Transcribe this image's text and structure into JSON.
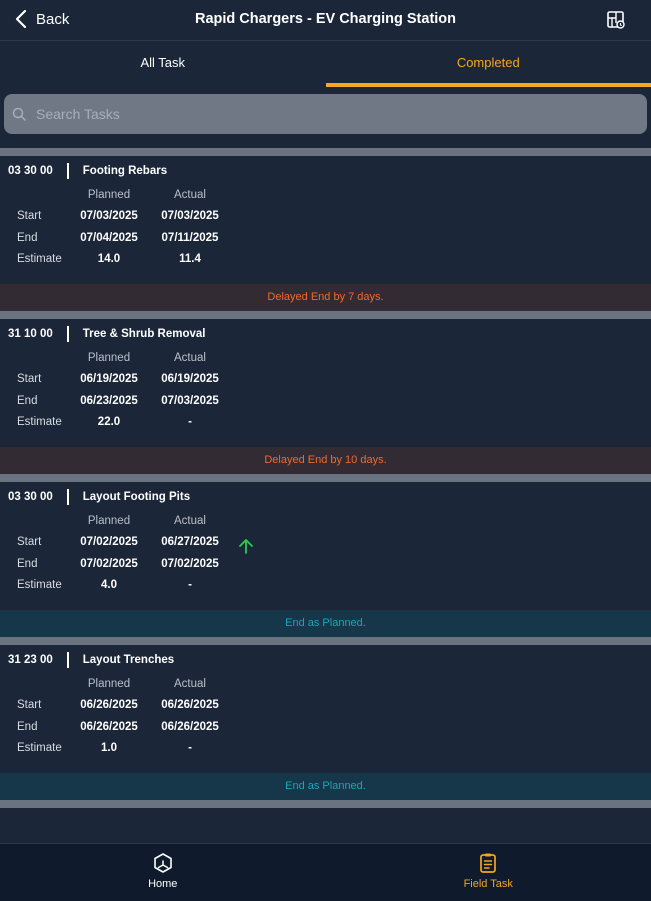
{
  "header": {
    "back_label": "Back",
    "title": "Rapid Chargers - EV Charging Station",
    "menu_icon": "project-map-icon"
  },
  "tabs": [
    {
      "label": "All Task",
      "active": false
    },
    {
      "label": "Completed",
      "active": true
    }
  ],
  "search": {
    "placeholder": "Search Tasks",
    "value": ""
  },
  "columns": {
    "planned": "Planned",
    "actual": "Actual"
  },
  "row_labels": {
    "start": "Start",
    "end": "End",
    "estimate": "Estimate"
  },
  "tasks": [
    {
      "code": "03 30 00",
      "name": "Footing Rebars",
      "planned_start": "07/03/2025",
      "actual_start": "07/03/2025",
      "planned_end": "07/04/2025",
      "actual_end": "07/11/2025",
      "planned_estimate": "14.0",
      "actual_estimate": "11.4",
      "status": "Delayed End by 7 days.",
      "status_type": "delayed",
      "indicator": ""
    },
    {
      "code": "31 10 00",
      "name": "Tree & Shrub Removal",
      "planned_start": "06/19/2025",
      "actual_start": "06/19/2025",
      "planned_end": "06/23/2025",
      "actual_end": "07/03/2025",
      "planned_estimate": "22.0",
      "actual_estimate": "-",
      "status": "Delayed End by 10 days.",
      "status_type": "delayed",
      "indicator": ""
    },
    {
      "code": "03 30 00",
      "name": "Layout Footing Pits",
      "planned_start": "07/02/2025",
      "actual_start": "06/27/2025",
      "planned_end": "07/02/2025",
      "actual_end": "07/02/2025",
      "planned_estimate": "4.0",
      "actual_estimate": "-",
      "status": "End as Planned.",
      "status_type": "ok",
      "indicator": "arrow-up-icon"
    },
    {
      "code": "31 23 00",
      "name": "Layout Trenches",
      "planned_start": "06/26/2025",
      "actual_start": "06/26/2025",
      "planned_end": "06/26/2025",
      "actual_end": "06/26/2025",
      "planned_estimate": "1.0",
      "actual_estimate": "-",
      "status": "End as Planned.",
      "status_type": "ok",
      "indicator": ""
    }
  ],
  "bottom_nav": [
    {
      "label": "Home",
      "icon": "home-icon",
      "active": false
    },
    {
      "label": "Field Task",
      "icon": "clipboard-icon",
      "active": true
    }
  ],
  "colors": {
    "accent": "#f5a623",
    "delayed": "#f06a2c",
    "ok": "#19a6b8",
    "arrow": "#2ecc52"
  }
}
